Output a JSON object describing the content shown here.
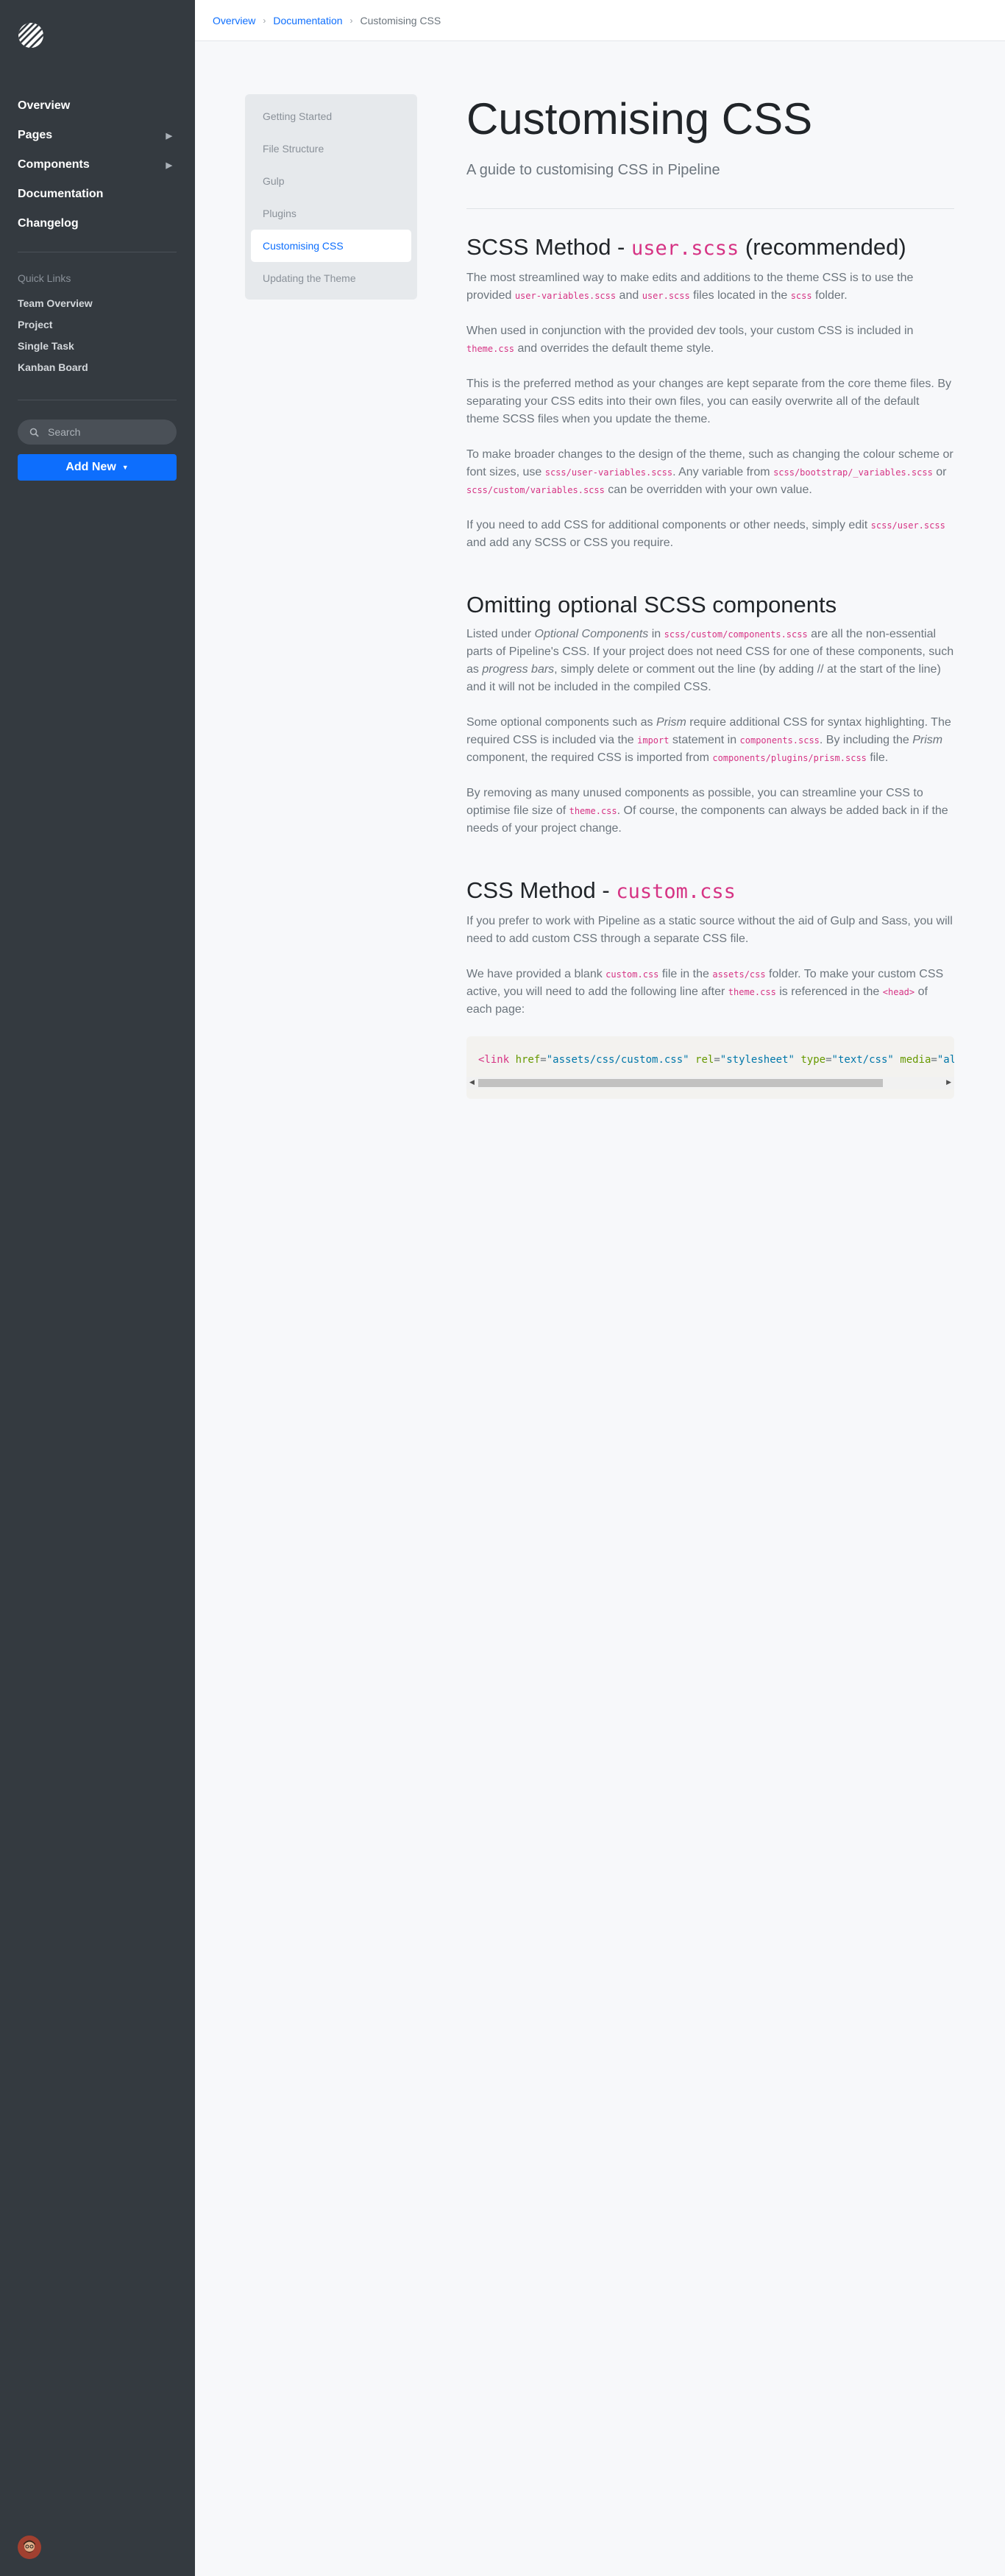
{
  "sidebar": {
    "nav": [
      {
        "label": "Overview",
        "has_children": false
      },
      {
        "label": "Pages",
        "has_children": true
      },
      {
        "label": "Components",
        "has_children": true
      },
      {
        "label": "Documentation",
        "has_children": false
      },
      {
        "label": "Changelog",
        "has_children": false
      }
    ],
    "quick_links_title": "Quick Links",
    "quick_links": [
      "Team Overview",
      "Project",
      "Single Task",
      "Kanban Board"
    ],
    "search_placeholder": "Search",
    "add_new_label": "Add New"
  },
  "breadcrumb": {
    "items": [
      "Overview",
      "Documentation"
    ],
    "current": "Customising CSS"
  },
  "doc_nav": {
    "items": [
      "Getting Started",
      "File Structure",
      "Gulp",
      "Plugins",
      "Customising CSS",
      "Updating the Theme"
    ],
    "active": "Customising CSS"
  },
  "page": {
    "title": "Customising CSS",
    "lead": "A guide to customising CSS in Pipeline"
  },
  "sections": {
    "s1": {
      "h_pre": "SCSS Method - ",
      "h_code": "user.scss",
      "h_post": " (recommended)",
      "p1": [
        "The most streamlined way to make edits and additions to the theme CSS is to use the provided ",
        "user-variables.scss",
        " and ",
        "user.scss",
        " files located in the ",
        "scss",
        " folder."
      ],
      "p2": [
        "When used in conjunction with the provided dev tools, your custom CSS is included in ",
        "theme.css",
        " and overrides the default theme style."
      ],
      "p3": "This is the preferred method as your changes are kept separate from the core theme files. By separating your CSS edits into their own files, you can easily overwrite all of the default theme SCSS files when you update the theme.",
      "p4": [
        "To make broader changes to the design of the theme, such as changing the colour scheme or font sizes, use ",
        "scss/user-variables.scss",
        ". Any variable from ",
        "scss/bootstrap/_variables.scss",
        " or ",
        "scss/custom/variables.scss",
        " can be overridden with your own value."
      ],
      "p5": [
        "If you need to add CSS for additional components or other needs, simply edit ",
        "scss/user.scss",
        " and add any SCSS or CSS you require."
      ]
    },
    "s2": {
      "h": "Omitting optional SCSS components",
      "p1": [
        "Listed under ",
        "Optional Components",
        " in ",
        "scss/custom/components.scss",
        " are all the non-essential parts of Pipeline's CSS. If your project does not need CSS for one of these components, such as ",
        "progress bars",
        ", simply delete or comment out the line (by adding // at the start of the line) and it will not be included in the compiled CSS."
      ],
      "p2": [
        "Some optional components such as ",
        "Prism",
        " require additional CSS for syntax highlighting. The required CSS is included via the ",
        "import",
        " statement in ",
        "components.scss",
        ". By including the ",
        "Prism",
        " component, the required CSS is imported from ",
        "components/plugins/prism.scss",
        " file."
      ],
      "p3": [
        "By removing as many unused components as possible, you can streamline your CSS to optimise file size of ",
        "theme.css",
        ". Of course, the components can always be added back in if the needs of your project change."
      ]
    },
    "s3": {
      "h_pre": "CSS Method - ",
      "h_code": "custom.css",
      "p1": "If you prefer to work with Pipeline as a static source without the aid of Gulp and Sass, you will need to add custom CSS through a separate CSS file.",
      "p2": [
        "We have provided a blank ",
        "custom.css",
        " file in the ",
        "assets/css",
        " folder. To make your custom CSS active, you will need to add the following line after ",
        "theme.css",
        " is referenced in the ",
        "<head>",
        " of each page:"
      ],
      "code": {
        "open": "<link ",
        "a1": "href",
        "v1": "\"assets/css/custom.css\"",
        "a2": "rel",
        "v2": "\"stylesheet\"",
        "a3": "type",
        "v3": "\"text/css\"",
        "a4": "media",
        "v4": "\"all\"",
        "eq": "=",
        "close": " />"
      }
    }
  }
}
